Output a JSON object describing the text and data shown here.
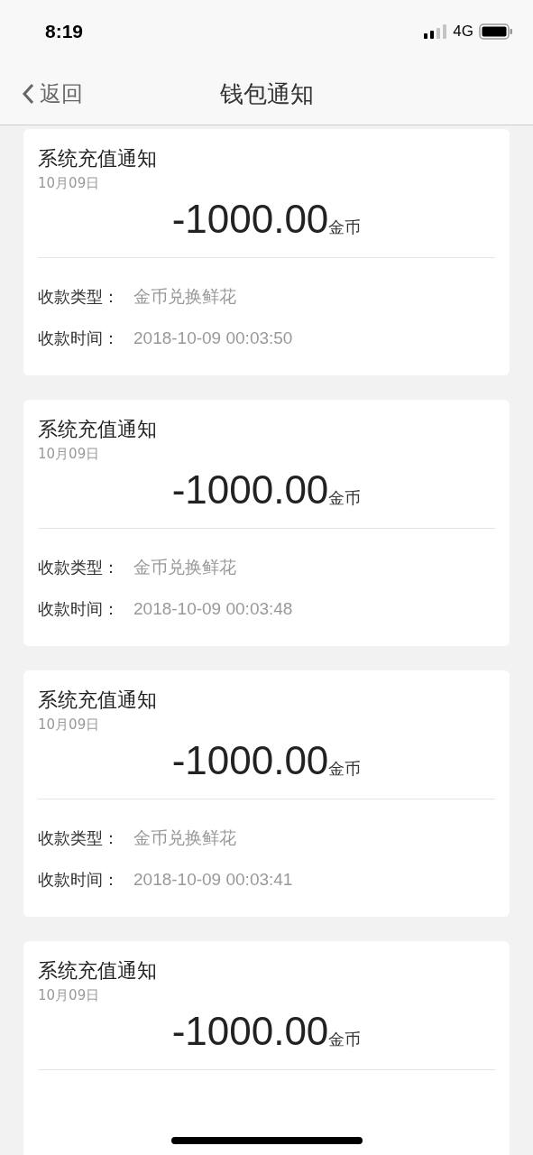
{
  "status_bar": {
    "time": "8:19",
    "network": "4G"
  },
  "nav": {
    "back": "返回",
    "title": "钱包通知"
  },
  "cards": [
    {
      "title": "系统充值通知",
      "date": "10月09日",
      "amount": "-1000.00",
      "unit": "金币",
      "rows": [
        {
          "label": "收款类型：",
          "value": "金币兑换鲜花"
        },
        {
          "label": "收款时间：",
          "value": "2018-10-09 00:03:50"
        }
      ]
    },
    {
      "title": "系统充值通知",
      "date": "10月09日",
      "amount": "-1000.00",
      "unit": "金币",
      "rows": [
        {
          "label": "收款类型：",
          "value": "金币兑换鲜花"
        },
        {
          "label": "收款时间：",
          "value": "2018-10-09 00:03:48"
        }
      ]
    },
    {
      "title": "系统充值通知",
      "date": "10月09日",
      "amount": "-1000.00",
      "unit": "金币",
      "rows": [
        {
          "label": "收款类型：",
          "value": "金币兑换鲜花"
        },
        {
          "label": "收款时间：",
          "value": "2018-10-09 00:03:41"
        }
      ]
    },
    {
      "title": "系统充值通知",
      "date": "10月09日",
      "amount": "-1000.00",
      "unit": "金币"
    }
  ]
}
